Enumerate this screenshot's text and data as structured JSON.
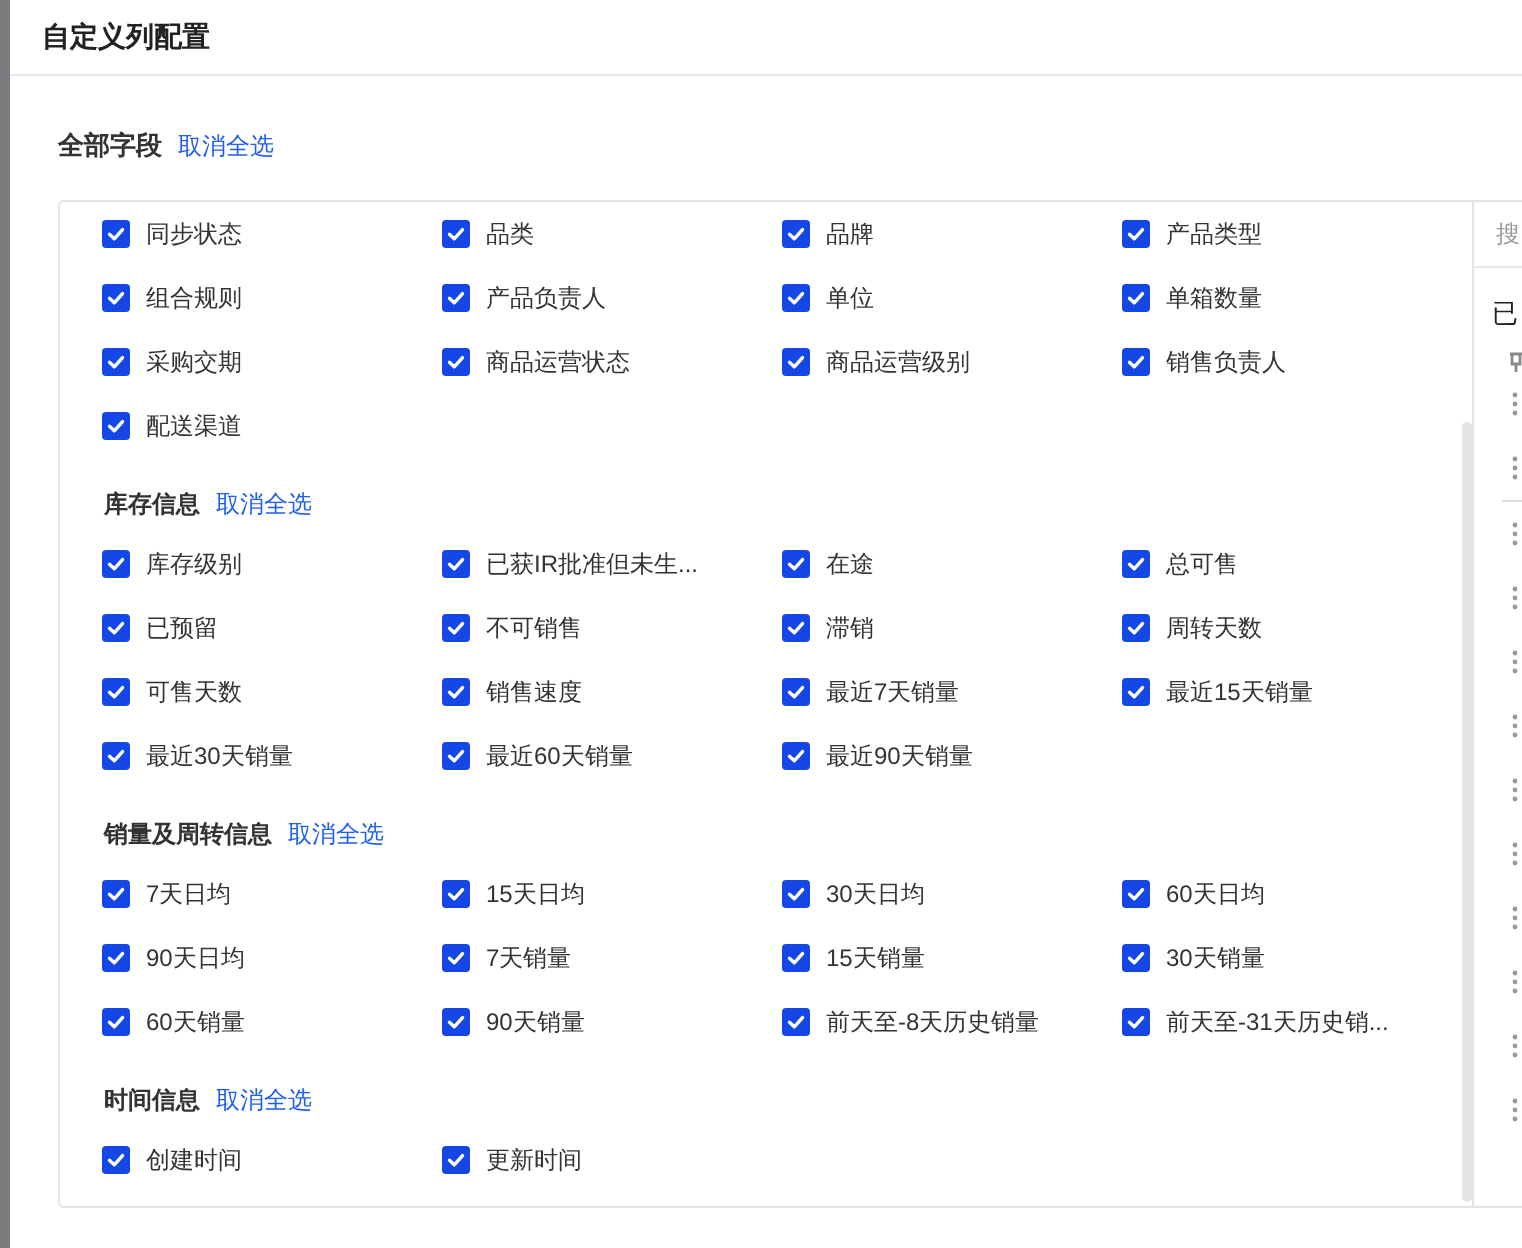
{
  "dialog": {
    "title": "自定义列配置"
  },
  "all_fields": {
    "title": "全部字段",
    "action": "取消全选"
  },
  "groups": [
    {
      "fields": [
        {
          "label": "同步状态",
          "checked": true
        },
        {
          "label": "品类",
          "checked": true
        },
        {
          "label": "品牌",
          "checked": true
        },
        {
          "label": "产品类型",
          "checked": true
        },
        {
          "label": "组合规则",
          "checked": true
        },
        {
          "label": "产品负责人",
          "checked": true
        },
        {
          "label": "单位",
          "checked": true
        },
        {
          "label": "单箱数量",
          "checked": true
        },
        {
          "label": "采购交期",
          "checked": true
        },
        {
          "label": "商品运营状态",
          "checked": true
        },
        {
          "label": "商品运营级别",
          "checked": true
        },
        {
          "label": "销售负责人",
          "checked": true
        },
        {
          "label": "配送渠道",
          "checked": true
        }
      ]
    },
    {
      "title": "库存信息",
      "action": "取消全选",
      "fields": [
        {
          "label": "库存级别",
          "checked": true
        },
        {
          "label": "已获IR批准但未生...",
          "checked": true
        },
        {
          "label": "在途",
          "checked": true
        },
        {
          "label": "总可售",
          "checked": true
        },
        {
          "label": "已预留",
          "checked": true
        },
        {
          "label": "不可销售",
          "checked": true
        },
        {
          "label": "滞销",
          "checked": true
        },
        {
          "label": "周转天数",
          "checked": true
        },
        {
          "label": "可售天数",
          "checked": true
        },
        {
          "label": "销售速度",
          "checked": true
        },
        {
          "label": "最近7天销量",
          "checked": true
        },
        {
          "label": "最近15天销量",
          "checked": true
        },
        {
          "label": "最近30天销量",
          "checked": true
        },
        {
          "label": "最近60天销量",
          "checked": true
        },
        {
          "label": "最近90天销量",
          "checked": true
        }
      ]
    },
    {
      "title": "销量及周转信息",
      "action": "取消全选",
      "fields": [
        {
          "label": "7天日均",
          "checked": true
        },
        {
          "label": "15天日均",
          "checked": true
        },
        {
          "label": "30天日均",
          "checked": true
        },
        {
          "label": "60天日均",
          "checked": true
        },
        {
          "label": "90天日均",
          "checked": true
        },
        {
          "label": "7天销量",
          "checked": true
        },
        {
          "label": "15天销量",
          "checked": true
        },
        {
          "label": "30天销量",
          "checked": true
        },
        {
          "label": "60天销量",
          "checked": true
        },
        {
          "label": "90天销量",
          "checked": true
        },
        {
          "label": "前天至-8天历史销量",
          "checked": true
        },
        {
          "label": "前天至-31天历史销...",
          "checked": true
        }
      ]
    },
    {
      "title": "时间信息",
      "action": "取消全选",
      "fields": [
        {
          "label": "创建时间",
          "checked": true
        },
        {
          "label": "更新时间",
          "checked": true
        }
      ]
    }
  ],
  "selected_panel": {
    "search_placeholder": "搜",
    "title": "已"
  }
}
